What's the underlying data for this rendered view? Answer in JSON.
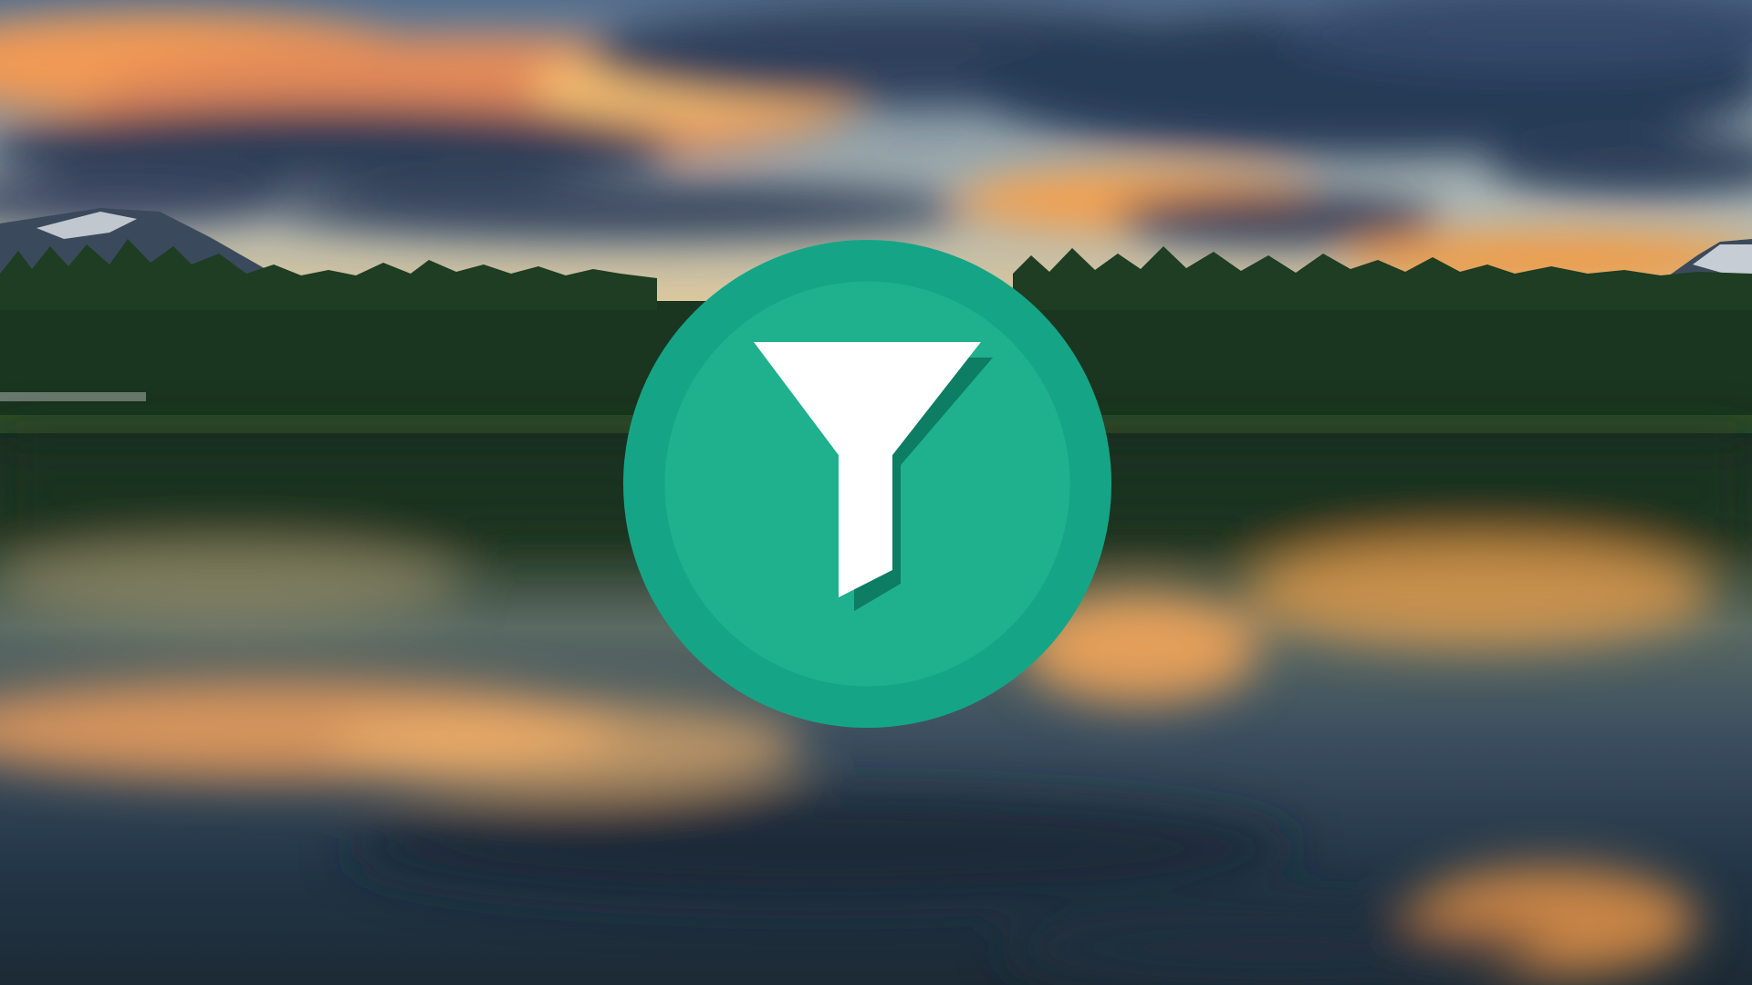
{
  "scene": {
    "subject": "sunset-lake-landscape",
    "elements": [
      "sky",
      "clouds",
      "mountains",
      "forest",
      "lake",
      "reflection"
    ],
    "colors": {
      "sky_top": "#5a7390",
      "sky_glow": "#f0c98c",
      "cloud_dark": "#2c3d58",
      "cloud_warm": "#f39a4c",
      "forest": "#1b3a1f",
      "water": "#24343f",
      "reflection_warm": "#f2a05a"
    }
  },
  "badge": {
    "icon": "filter-funnel-icon",
    "colors": {
      "outer_ring": "#15a586",
      "inner_disc": "#1fb18e",
      "funnel": "#ffffff",
      "funnel_shadow": "#0d7d63"
    }
  }
}
